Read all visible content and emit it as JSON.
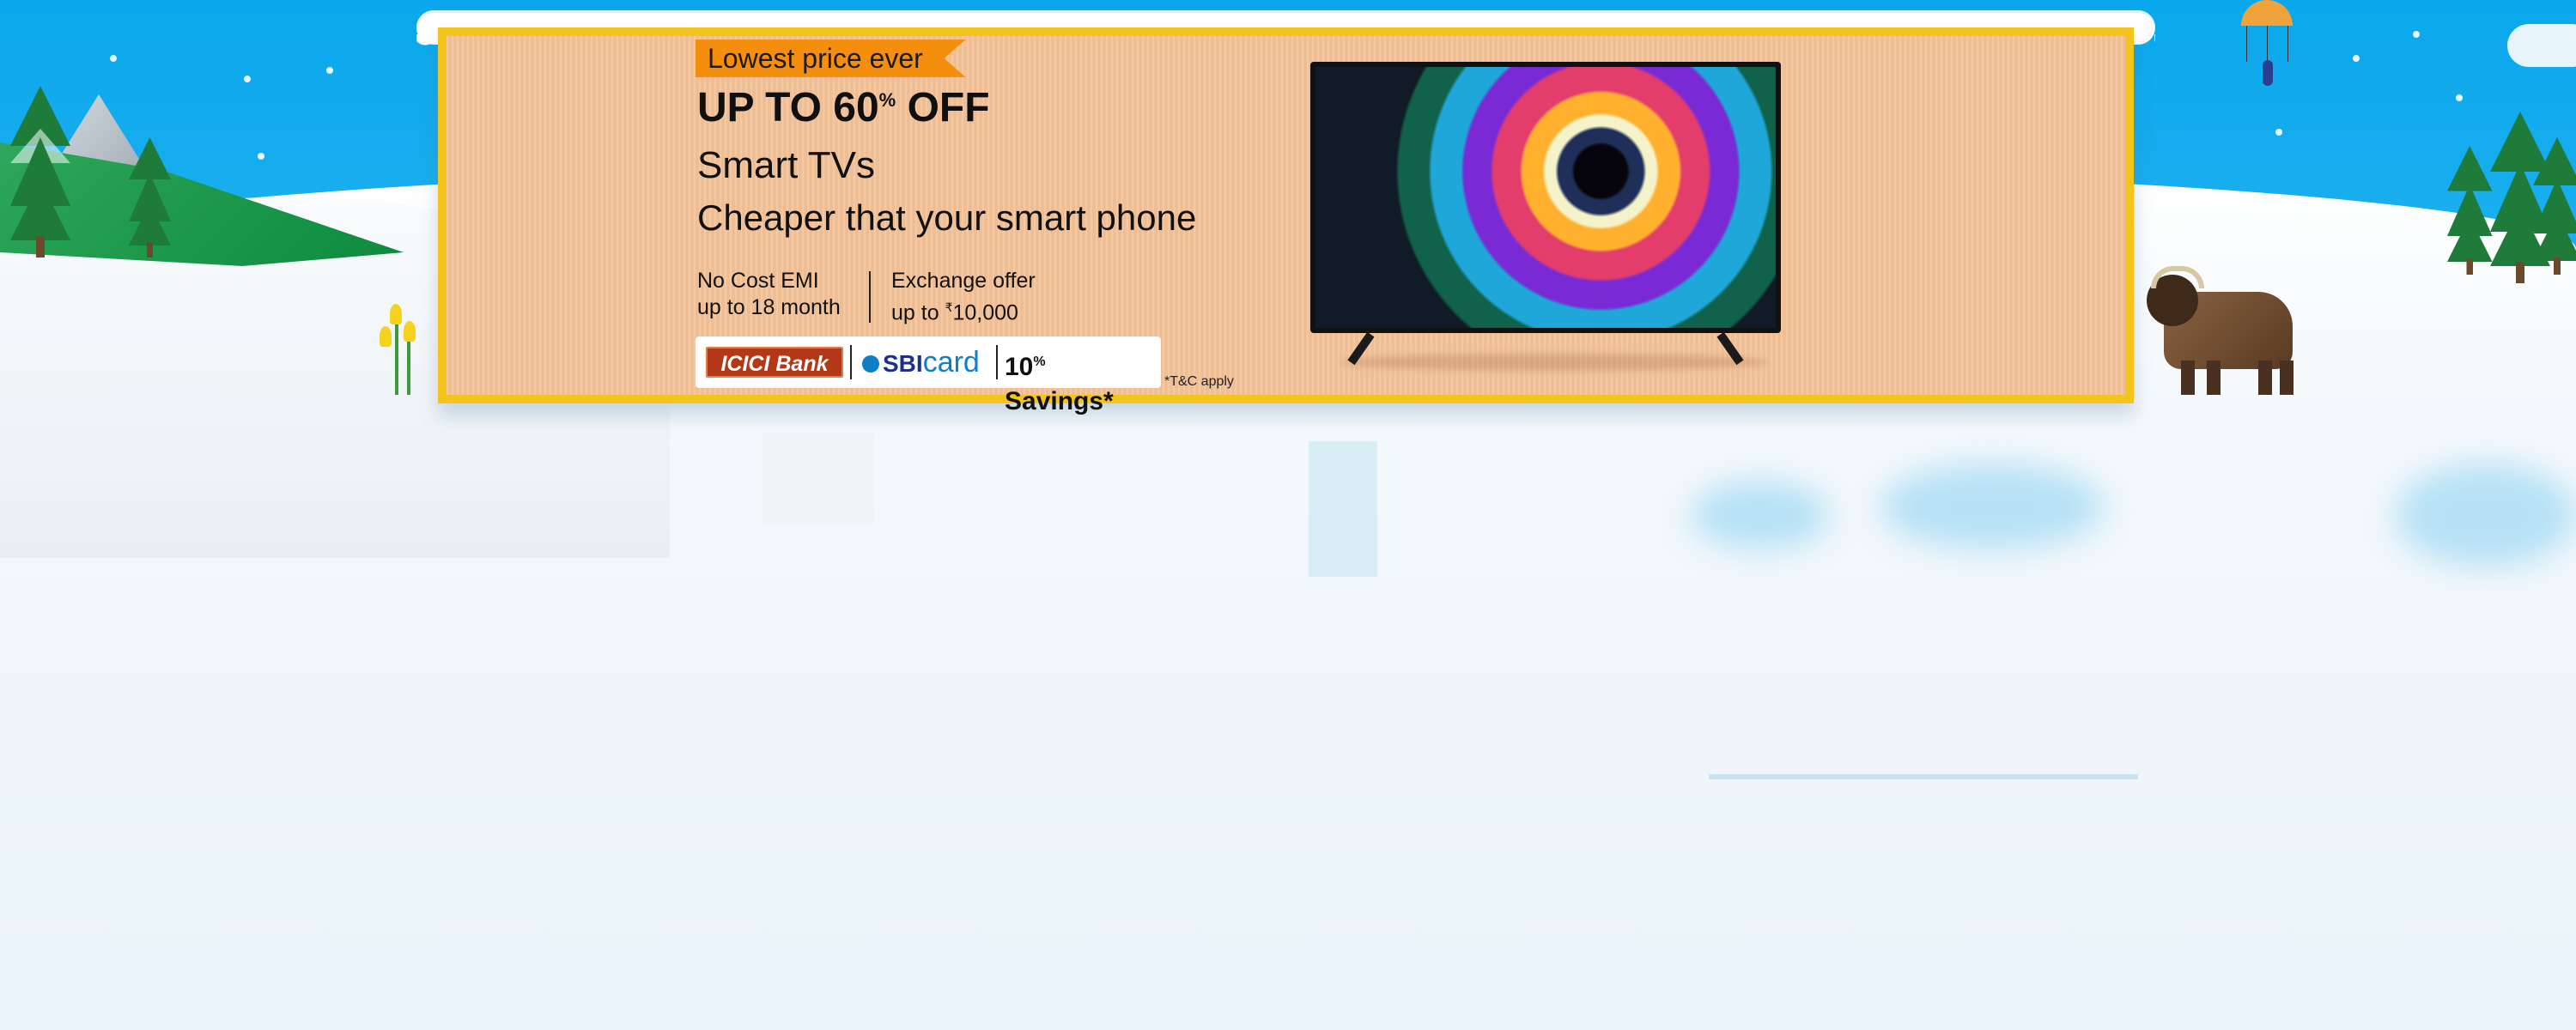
{
  "banner": {
    "badge": "Lowest price ever",
    "headline_main": "UP TO 60",
    "headline_percent": "%",
    "headline_off": " OFF",
    "product": "Smart TVs",
    "tagline": "Cheaper that your smart phone",
    "emi": {
      "line1": "No Cost EMI",
      "line2": "up to 18 month"
    },
    "exchange": {
      "line1": "Exchange offer",
      "line2_prefix": "up to ",
      "line2_currency": "₹",
      "line2_amount": "10,000"
    },
    "banks": {
      "icici": "ICICI Bank",
      "sbi_main": "SBI",
      "sbi_card": "card",
      "savings_value": "10",
      "savings_percent": "%",
      "savings_label": " Savings*"
    },
    "tnc": "*T&C apply"
  },
  "colors": {
    "sky": "#0aa7ec",
    "banner_bg": "#f6c59b",
    "banner_border": "#f2c41c",
    "badge_bg": "#f58e0c",
    "icici_bg": "#b33818",
    "sbi_blue": "#0f7ec8"
  },
  "icons": {
    "tv": "smart-tv-image",
    "yak": "yak-illustration",
    "parachute": "parachute-illustration"
  }
}
